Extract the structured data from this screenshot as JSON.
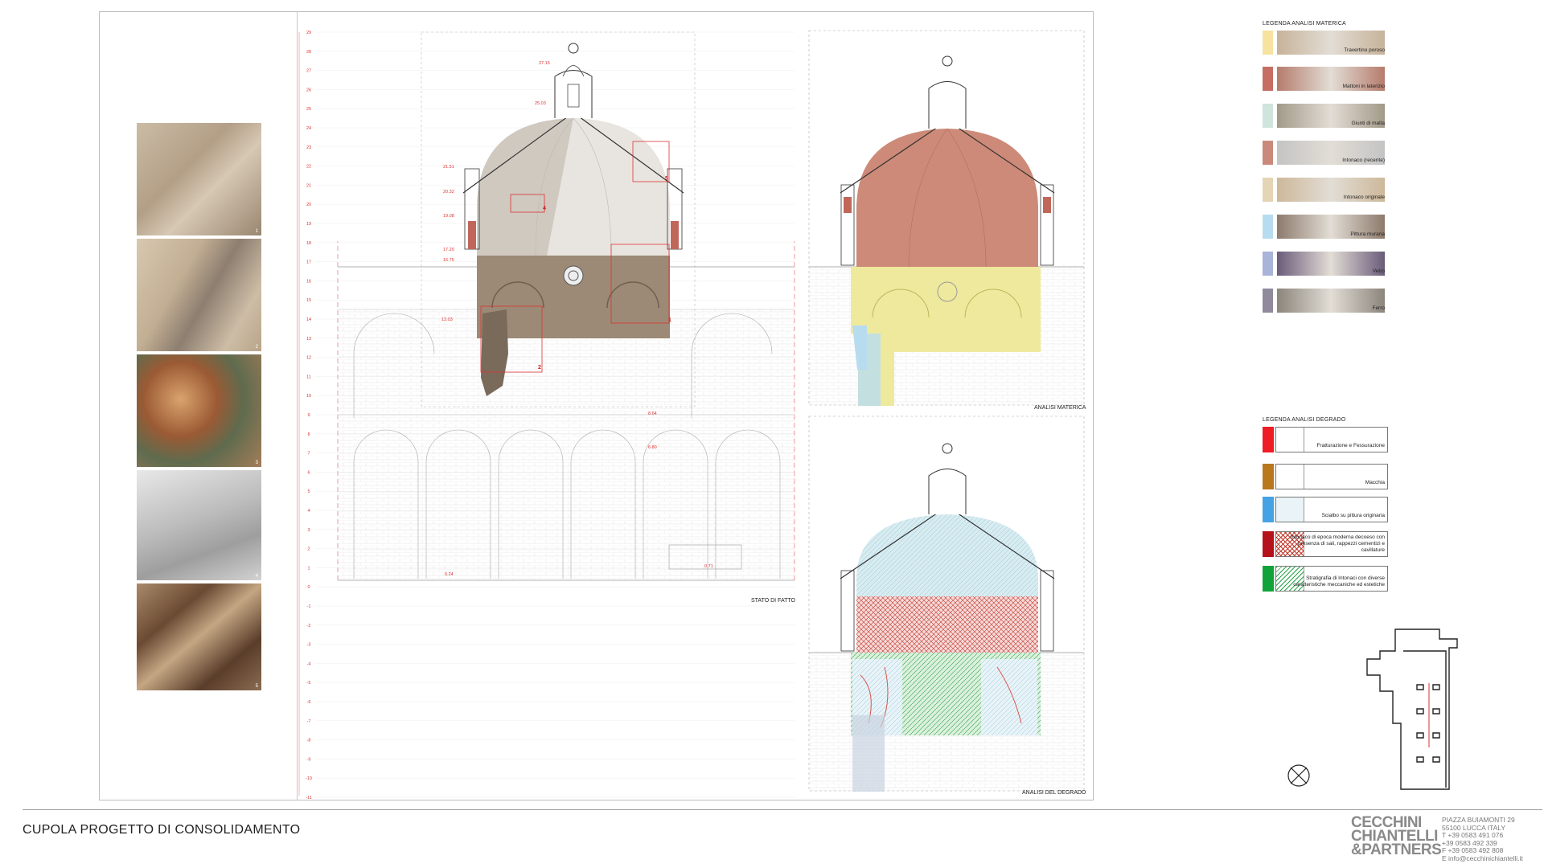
{
  "title": "CUPOLA PROGETTO DI CONSOLIDAMENTO",
  "section_labels": {
    "stato": "STATO DI FATTO",
    "materica": "ANALISI MATERICA",
    "degrado": "ANALISI DEL DEGRADO"
  },
  "scale_ticks": [
    "29",
    "28",
    "27",
    "26",
    "25",
    "24",
    "23",
    "22",
    "21",
    "20",
    "19",
    "18",
    "17",
    "16",
    "15",
    "14",
    "13",
    "12",
    "11",
    "10",
    "9",
    "8",
    "7",
    "6",
    "5",
    "4",
    "3",
    "2",
    "1",
    "0",
    "-1",
    "-2",
    "-3",
    "-4",
    "-5",
    "-6",
    "-7",
    "-8",
    "-9",
    "-10",
    "-11"
  ],
  "elevations": [
    "27.15",
    "25.03",
    "21.51",
    "20.32",
    "19.08",
    "17.20",
    "16.75",
    "13.03",
    "8.64",
    "6.80",
    "0.24",
    "0.71"
  ],
  "markers": [
    "1",
    "2",
    "4",
    "5"
  ],
  "photos": [
    {
      "num": "1",
      "tone": "#b9aa95"
    },
    {
      "num": "2",
      "tone": "#bfae98"
    },
    {
      "num": "3",
      "tone": "#8f6a48"
    },
    {
      "num": "4",
      "tone": "#c9c9c9"
    },
    {
      "num": "5",
      "tone": "#7d5f45"
    }
  ],
  "legend_materica": {
    "title": "LEGENDA ANALISI MATERICA",
    "items": [
      {
        "label": "Travertino poroso",
        "swatch": "#f6e39f",
        "tex": "#c7b39a"
      },
      {
        "label": "Mattoni in laterizio",
        "swatch": "#c66e63",
        "tex": "#b57c6d"
      },
      {
        "label": "Giunti di malta",
        "swatch": "#cfe4dd",
        "tex": "#a29988"
      },
      {
        "label": "Intonaco (recente)",
        "swatch": "#c98a7c",
        "tex": "#c4c4c4"
      },
      {
        "label": "Intonaco originale",
        "swatch": "#e4d5b4",
        "tex": "#cdb89a"
      },
      {
        "label": "Pittura muraria",
        "swatch": "#b8dcef",
        "tex": "#8d7a6c"
      },
      {
        "label": "Vetro",
        "swatch": "#aab3d8",
        "tex": "#6a5b7a"
      },
      {
        "label": "Ferro",
        "swatch": "#8f8a9c",
        "tex": "#8b857c"
      }
    ]
  },
  "legend_degrado": {
    "title": "LEGENDA ANALISI DEGRADO",
    "items": [
      {
        "label": "Fratturazione e Fessurazione",
        "swatch": "#ee1c25"
      },
      {
        "label": "Macchia",
        "swatch": "#b9771e"
      },
      {
        "label": "Scialbo su pittura originaria",
        "swatch": "#45a3e5"
      },
      {
        "label": "Intonaco di epoca moderna decoeso con presenza di sali, rappezzi cementizi e cavillature",
        "swatch": "#b5121b"
      },
      {
        "label": "Stratigrafia di Intonaci con diverse caratteristiche meccaniche ed estetiche",
        "swatch": "#11a33a"
      }
    ]
  },
  "logo": [
    "CECCHINI",
    "CHIANTELLI",
    "&PARTNERS"
  ],
  "address": [
    "PIAZZA BUIAMONTI 29",
    "55100  LUCCA  ITALY",
    "T +39 0583 491 076",
    "  +39 0583 492 339",
    "F +39 0583 492 808",
    "E info@cecchinichiantelli.it"
  ]
}
